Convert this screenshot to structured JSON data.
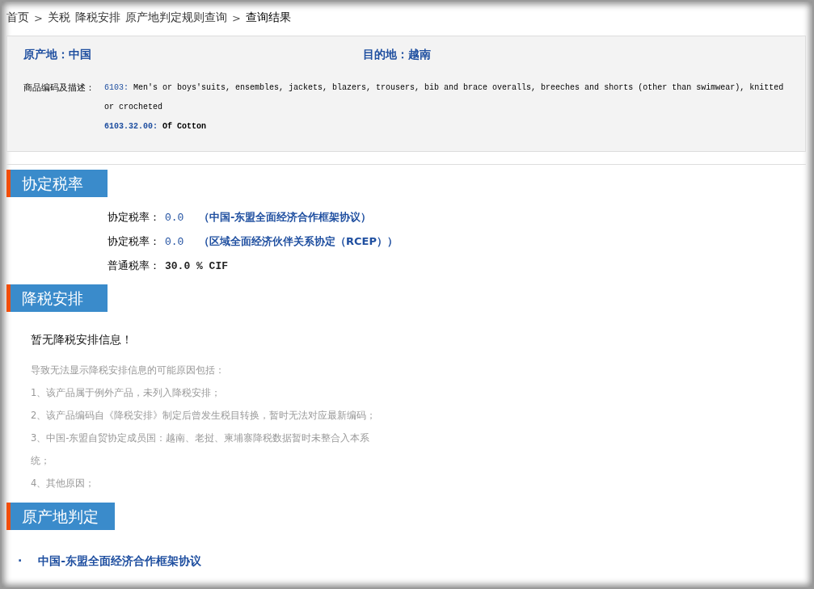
{
  "breadcrumb": [
    {
      "kind": "link",
      "text": "首页"
    },
    {
      "kind": "sep",
      "text": ">"
    },
    {
      "kind": "link",
      "text": "关税"
    },
    {
      "kind": "link",
      "text": "降税安排"
    },
    {
      "kind": "link",
      "text": "原产地判定规则查询"
    },
    {
      "kind": "sep",
      "text": ">"
    },
    {
      "kind": "current",
      "text": "查询结果"
    }
  ],
  "info": {
    "origin": "原产地：中国",
    "destination": "目的地：越南",
    "desc_label": "商品编码及描述：",
    "heading_code": "6103:",
    "heading_text": "Men's or boys'suits, ensembles, jackets, blazers, trousers, bib and brace overalls, breeches and shorts (other than swimwear), knitted or crocheted",
    "sub_code": "6103.32.00:",
    "sub_text": "Of Cotton"
  },
  "sections": [
    {
      "title": "协定税率",
      "kind": "rates",
      "rates": [
        {
          "kind": "agreement",
          "label": "协定税率：",
          "value": "0.0",
          "agreement": "（中国-东盟全面经济合作框架协议）"
        },
        {
          "kind": "agreement",
          "label": "协定税率：",
          "value": "0.0",
          "agreement": "（区域全面经济伙伴关系协定（RCEP））"
        },
        {
          "kind": "general",
          "label": "普通税率：",
          "value": "30.0 % CIF"
        }
      ]
    },
    {
      "title": "降税安排",
      "kind": "notice",
      "message": "暂无降税安排信息！",
      "reasons": [
        "导致无法显示降税安排信息的可能原因包括：",
        "1、该产品属于例外产品，未列入降税安排；",
        "2、该产品编码自《降税安排》制定后曾发生税目转换，暂时无法对应最新编码；",
        "3、中国-东盟自贸协定成员国：越南、老挝、柬埔寨降税数据暂时未整合入本系统；",
        "4、其他原因；"
      ]
    },
    {
      "title": "原产地判定",
      "kind": "links",
      "bullet": "·",
      "links": [
        "中国-东盟全面经济合作框架协议"
      ]
    }
  ]
}
